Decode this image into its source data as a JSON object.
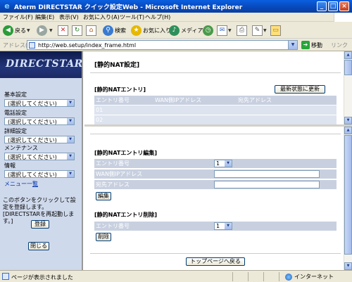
{
  "window": {
    "title": "Aterm DIRECTSTAR クイック設定Web - Microsoft Internet Explorer",
    "minimize": "_",
    "maximize": "□",
    "close": "×"
  },
  "menubar": {
    "items": [
      "ファイル(F)",
      "編集(E)",
      "表示(V)",
      "お気に入り(A)",
      "ツール(T)",
      "ヘルプ(H)"
    ]
  },
  "toolbar": {
    "back": "戻る",
    "search": "検索",
    "favorites": "お気に入り",
    "media": "メディア"
  },
  "address": {
    "label": "アドレス(D)",
    "url": "http://web.setup/index_frame.html",
    "go": "移動",
    "links": "リンク"
  },
  "left": {
    "logo": "DIRECTSTAR",
    "sections": [
      {
        "title": "基本設定",
        "selected": "(選択してください)"
      },
      {
        "title": "電話設定",
        "selected": "(選択してください)"
      },
      {
        "title": "詳細設定",
        "selected": "(選択してください)"
      },
      {
        "title": "メンテナンス",
        "selected": "(選択してください)"
      },
      {
        "title": "情報",
        "selected": "(選択してください)"
      }
    ],
    "menu_list_prefix": "メニュー一",
    "menu_list_link": "覧",
    "note": "このボタンをクリックして設定を登録します。[DIRECTSTARを再起動します。]",
    "register": "登録",
    "close": "閉じる"
  },
  "main": {
    "page_title": "[静的NAT設定]",
    "list_title": "[静的NATエントリ]",
    "refresh": "最新状態に更新",
    "columns": [
      "エントリ番号",
      "WAN側IPアドレス",
      "宛先アドレス"
    ],
    "rows": [
      [
        "01",
        "",
        ""
      ],
      [
        "02",
        "",
        ""
      ]
    ],
    "edit_title": "[静的NATエントリ編集]",
    "edit_fields": {
      "entry_label": "エントリ番号",
      "entry_value": "1",
      "wan_label": "WAN側IPアドレス",
      "wan_value": "",
      "dest_label": "宛先アドレス",
      "dest_value": ""
    },
    "edit_button": "編集",
    "delete_title": "[静的NATエントリ削除]",
    "delete_entry_label": "エントリ番号",
    "delete_entry_value": "1",
    "delete_button": "削除",
    "top_button": "トップページへ戻る"
  },
  "status": {
    "text": "ページが表示されました",
    "zone": "インターネット"
  }
}
